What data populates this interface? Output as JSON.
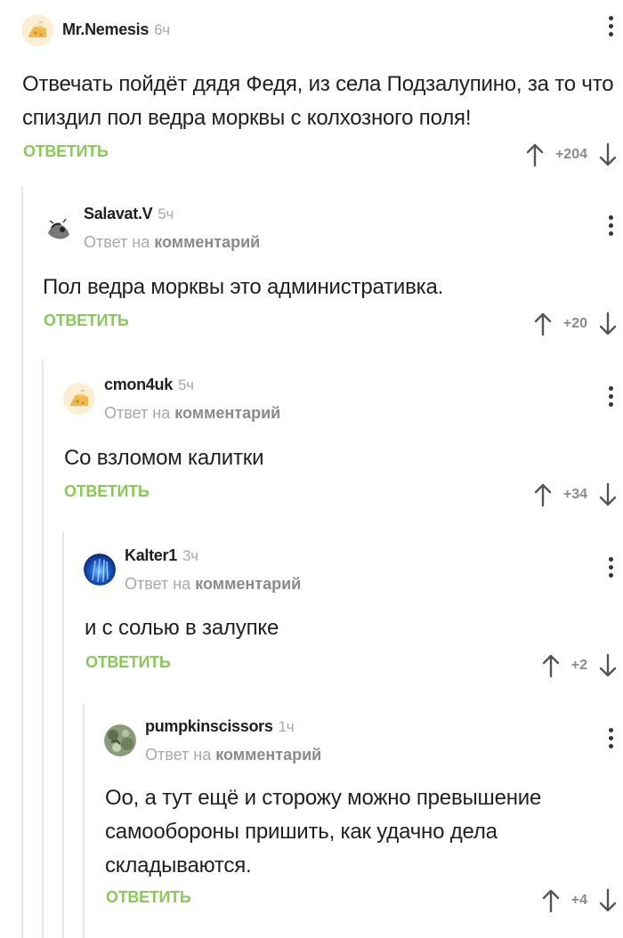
{
  "comments": [
    {
      "author": "Mr.Nemesis",
      "time": "6ч",
      "reply_prefix": "",
      "reply_target": "",
      "text": "Отвечать пойдёт дядя Федя, из села Подзалупино, за то что спиздил пол ведра морквы с колхозного поля!",
      "reply_label": "ОТВЕТИТЬ",
      "score": "+204"
    },
    {
      "author": "Salavat.V",
      "time": "5ч",
      "reply_prefix": "Ответ на",
      "reply_target": "комментарий",
      "text": "Пол ведра морквы это административка.",
      "reply_label": "ОТВЕТИТЬ",
      "score": "+20"
    },
    {
      "author": "cmon4uk",
      "time": "5ч",
      "reply_prefix": "Ответ на",
      "reply_target": "комментарий",
      "text": "Со взломом калитки",
      "reply_label": "ОТВЕТИТЬ",
      "score": "+34"
    },
    {
      "author": "Kalter1",
      "time": "3ч",
      "reply_prefix": "Ответ на",
      "reply_target": "комментарий",
      "text": "и с солью в залупке",
      "reply_label": "ОТВЕТИТЬ",
      "score": "+2"
    },
    {
      "author": "pumpkinscissors",
      "time": "1ч",
      "reply_prefix": "Ответ на",
      "reply_target": "комментарий",
      "text": "Оо, а тут ещё и сторожу можно превышение самообороны пришить, как удачно дела складываются.",
      "reply_label": "ОТВЕТИТЬ",
      "score": "+4"
    }
  ],
  "icons": {
    "menu": "more-vertical-icon",
    "upvote": "arrow-up-icon",
    "downvote": "arrow-down-icon"
  },
  "colors": {
    "reply_green": "#8ac858",
    "muted": "#a8a8a8",
    "thread_line": "#e6e6e6"
  }
}
